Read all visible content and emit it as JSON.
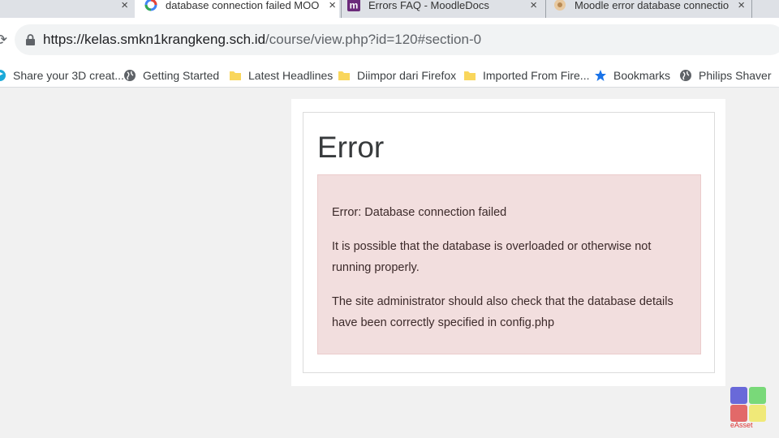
{
  "browser": {
    "tabs": [
      {
        "label": "database connection failed MOODLE",
        "icon": "google-icon",
        "close": "×"
      },
      {
        "label": "Errors FAQ - MoodleDocs",
        "icon": "moodle-icon",
        "close": "×"
      },
      {
        "label": "Moodle error database connection failed",
        "icon": "site-icon",
        "close": "×"
      }
    ],
    "leftover_close": "×",
    "url_host": "https://kelas.smkn1krangkeng.sch.id",
    "url_path": "/course/view.php?id=120#section-0",
    "bookmarks": [
      {
        "label": "Share your 3D creat...",
        "icon": "sketchfab-icon"
      },
      {
        "label": "Getting Started",
        "icon": "globe-icon"
      },
      {
        "label": "Latest Headlines",
        "icon": "folder-icon"
      },
      {
        "label": "Diimpor dari Firefox",
        "icon": "folder-icon"
      },
      {
        "label": "Imported From Fire...",
        "icon": "folder-icon"
      },
      {
        "label": "Bookmarks",
        "icon": "star-icon"
      },
      {
        "label": "Philips Shaver",
        "icon": "globe-icon"
      }
    ]
  },
  "page": {
    "title": "Error",
    "alert": {
      "line1": "Error: Database connection failed",
      "line2": "It is possible that the database is overloaded or otherwise not running properly.",
      "line3": "The site administrator should also check that the database details have been correctly specified in config.php"
    }
  },
  "watermark": {
    "text": "eAsset"
  },
  "colors": {
    "alert_bg": "#f2dede",
    "alert_border": "#ebcccc",
    "page_bg": "#f1f1f1",
    "bookmark_star": "#1a73e8",
    "folder": "#f9d65c"
  }
}
